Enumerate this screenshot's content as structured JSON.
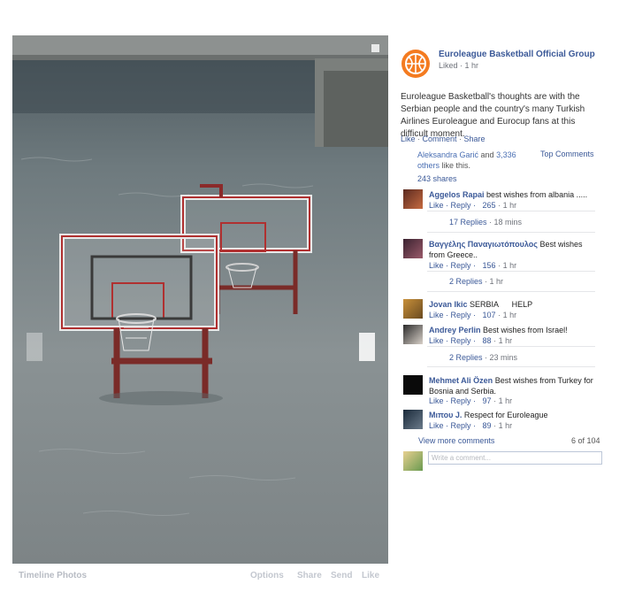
{
  "photo": {
    "alt_subject": "flooded basketball courts",
    "nav": {
      "left_icon": "prev-arrow-icon",
      "right_icon": "next-arrow-icon"
    }
  },
  "bottom_bar": {
    "album": "Timeline Photos",
    "options": "Options",
    "share": "Share",
    "send": "Send",
    "like": "Like"
  },
  "post": {
    "group_name": "Euroleague Basketball Official Group",
    "liked_time": "Liked · 1 hr",
    "text": "Euroleague Basketball's thoughts are with the Serbian people and the country's many Turkish Airlines Euroleague and Eurocup fans at this difficult moment.",
    "actions": {
      "like": "Like",
      "comment": "Comment",
      "share": "Share"
    },
    "likes": {
      "name": "Aleksandra Garić",
      "and": " and ",
      "others": "3,336 others",
      "suffix": " like this."
    },
    "top_comments": "Top Comments",
    "shares": "243 shares",
    "logo_color": "#f47b20"
  },
  "comments": [
    {
      "author": "Aggelos Rapai",
      "text": "best wishes from albania .....",
      "like": "Like",
      "reply": "Reply",
      "likes": "265",
      "time": "1 hr",
      "replies": "17 Replies",
      "replies_time": "18 mins"
    },
    {
      "author": "Βαγγέλης Παναγιωτόπουλος",
      "text": "Best wishes from Greece..",
      "like": "Like",
      "reply": "Reply",
      "likes": "156",
      "time": "1 hr",
      "replies": "2 Replies",
      "replies_time": "1 hr"
    },
    {
      "author": "Jovan Ikic",
      "text": "SERBIA      HELP",
      "like": "Like",
      "reply": "Reply",
      "likes": "107",
      "time": "1 hr"
    },
    {
      "author": "Andrey Perlin",
      "text": "Best wishes from Israel!",
      "like": "Like",
      "reply": "Reply",
      "likes": "88",
      "time": "1 hr",
      "replies": "2 Replies",
      "replies_time": "23 mins"
    },
    {
      "author": "Mehmet Ali Özen",
      "text": "Best wishes from Turkey for Bosnia and Serbia.",
      "like": "Like",
      "reply": "Reply",
      "likes": "97",
      "time": "1 hr"
    },
    {
      "author": "Μιπου J.",
      "text": "Respect for Euroleague",
      "like": "Like",
      "reply": "Reply",
      "likes": "89",
      "time": "1 hr"
    }
  ],
  "footer": {
    "view_more": "View more comments",
    "count": "6 of 104",
    "write_placeholder": "Write a comment..."
  }
}
